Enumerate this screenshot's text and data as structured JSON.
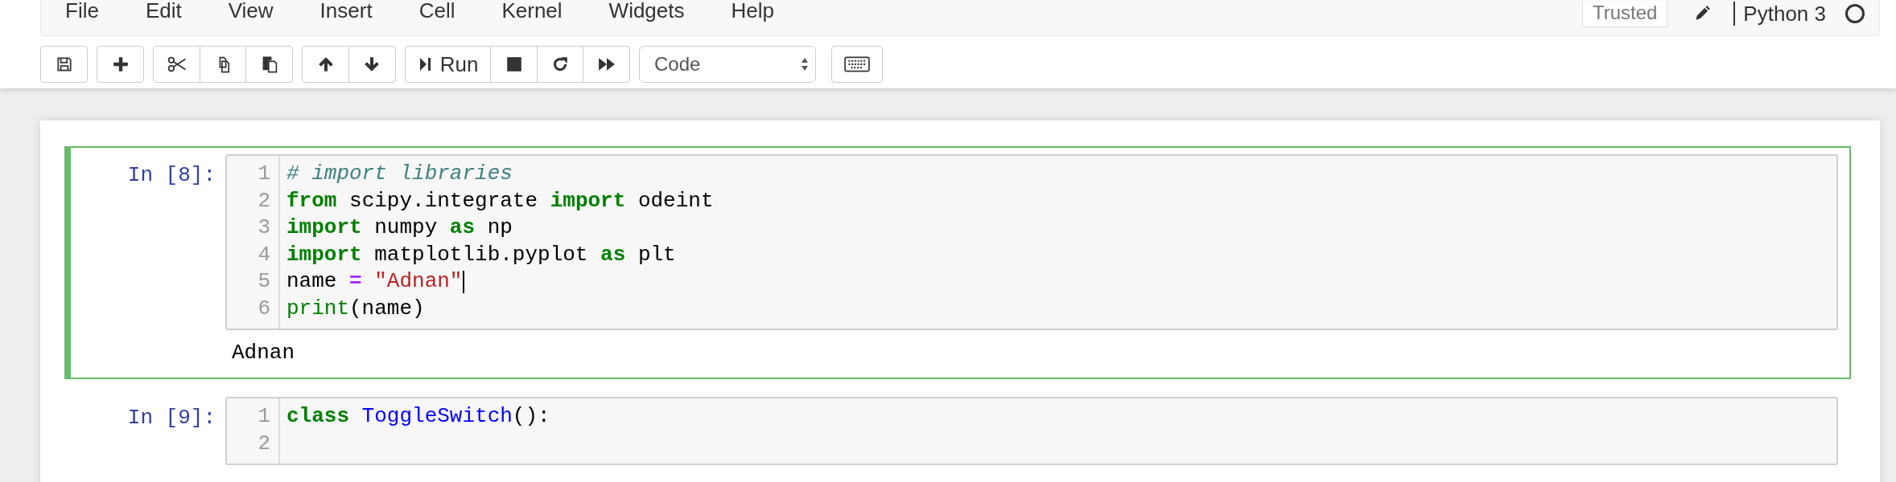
{
  "menu": [
    "File",
    "Edit",
    "View",
    "Insert",
    "Cell",
    "Kernel",
    "Widgets",
    "Help"
  ],
  "status": {
    "trusted": "Trusted",
    "kernel": "Python 3",
    "kernel_busy": false
  },
  "toolbar": [
    {
      "buttons": [
        {
          "kind": "save"
        }
      ]
    },
    {
      "buttons": [
        {
          "kind": "add"
        }
      ]
    },
    {
      "buttons": [
        {
          "kind": "cut"
        },
        {
          "kind": "copy"
        },
        {
          "kind": "paste"
        }
      ]
    },
    {
      "buttons": [
        {
          "kind": "up"
        },
        {
          "kind": "down"
        }
      ]
    },
    {
      "buttons": [
        {
          "kind": "run",
          "label": "Run"
        },
        {
          "kind": "stop"
        },
        {
          "kind": "restart"
        },
        {
          "kind": "fast-forward"
        }
      ]
    }
  ],
  "cell_type": "Code",
  "cells": [
    {
      "prompt": "In [8]:",
      "selected": true,
      "lines": [
        {
          "number": "1",
          "cursor": false,
          "tokens": [
            {
              "kind": "comment",
              "text": "# import libraries"
            }
          ]
        },
        {
          "number": "2",
          "cursor": false,
          "tokens": [
            {
              "kind": "keyword",
              "text": "from"
            },
            {
              "kind": "plain",
              "text": " scipy.integrate "
            },
            {
              "kind": "keyword",
              "text": "import"
            },
            {
              "kind": "plain",
              "text": " odeint"
            }
          ]
        },
        {
          "number": "3",
          "cursor": false,
          "tokens": [
            {
              "kind": "keyword",
              "text": "import"
            },
            {
              "kind": "plain",
              "text": " numpy "
            },
            {
              "kind": "keyword",
              "text": "as"
            },
            {
              "kind": "plain",
              "text": " np"
            }
          ]
        },
        {
          "number": "4",
          "cursor": false,
          "tokens": [
            {
              "kind": "keyword",
              "text": "import"
            },
            {
              "kind": "plain",
              "text": " matplotlib.pyplot "
            },
            {
              "kind": "keyword",
              "text": "as"
            },
            {
              "kind": "plain",
              "text": " plt"
            }
          ]
        },
        {
          "number": "5",
          "cursor": true,
          "tokens": [
            {
              "kind": "plain",
              "text": "name "
            },
            {
              "kind": "operator",
              "text": "="
            },
            {
              "kind": "string",
              "text": " \"Adnan\""
            }
          ]
        },
        {
          "number": "6",
          "cursor": false,
          "tokens": [
            {
              "kind": "builtin",
              "text": "print"
            },
            {
              "kind": "plain",
              "text": "(name)"
            }
          ]
        }
      ],
      "output": "Adnan"
    },
    {
      "prompt": "In [9]:",
      "selected": false,
      "lines": [
        {
          "number": "1",
          "cursor": false,
          "tokens": [
            {
              "kind": "keyword",
              "text": "class"
            },
            {
              "kind": "def",
              "text": " ToggleSwitch"
            },
            {
              "kind": "plain",
              "text": "():"
            }
          ]
        },
        {
          "number": "2",
          "cursor": false
        }
      ]
    }
  ]
}
